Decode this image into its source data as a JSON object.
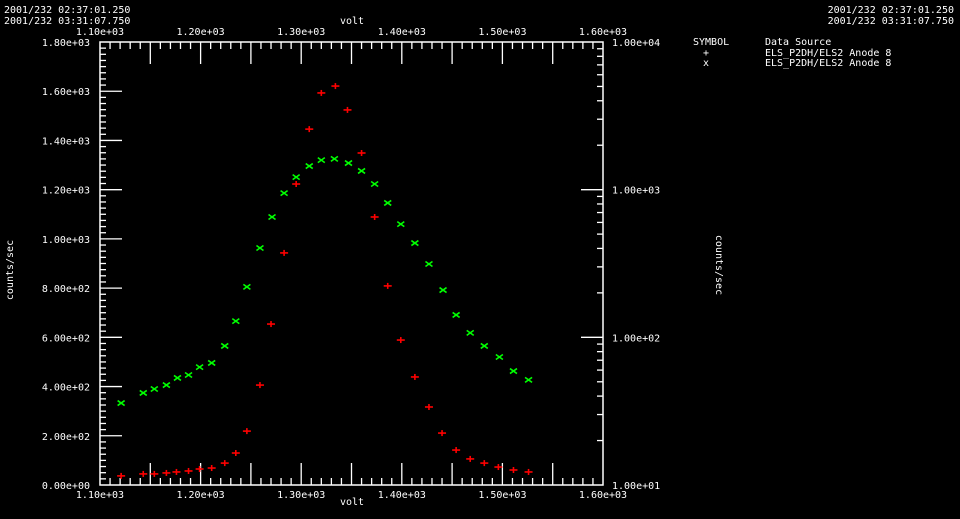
{
  "header": {
    "time_start": "2001/232 02:37:01.250",
    "time_end": "2001/232 03:31:07.750"
  },
  "legend": {
    "symbol_header": "SYMBOL",
    "source_header": "Data Source",
    "entries": [
      {
        "symbol": "+",
        "source": "ELS_P2DH/ELS2 Anode 8",
        "color": "#ff0000"
      },
      {
        "symbol": "x",
        "source": "ELS_P2DH/ELS2 Anode 8",
        "color": "#00ff00"
      }
    ]
  },
  "chart_data": {
    "type": "scatter",
    "xlabel": "volt",
    "ylabel": "counts/sec",
    "y2label": "counts/sec",
    "xlim": [
      1100,
      1600
    ],
    "ylim": [
      0,
      1800
    ],
    "y2lim": [
      10,
      10000
    ],
    "y2scale": "log",
    "x_ticks": [
      "1.10e+03",
      "1.20e+03",
      "1.30e+03",
      "1.40e+03",
      "1.50e+03",
      "1.60e+03"
    ],
    "y_ticks": [
      "0.00e+00",
      "2.00e+02",
      "4.00e+02",
      "6.00e+02",
      "8.00e+02",
      "1.00e+03",
      "1.20e+03",
      "1.40e+03",
      "1.60e+03",
      "1.80e+03"
    ],
    "y2_ticks": [
      "1.00e+01",
      "1.00e+02",
      "1.00e+03",
      "1.00e+04"
    ],
    "grid": false,
    "legend_position": "top-right",
    "series": [
      {
        "symbol": "+",
        "color": "#ff0000",
        "x": [
          1121,
          1143,
          1154,
          1166,
          1176,
          1188,
          1199,
          1211,
          1224,
          1235,
          1246,
          1259,
          1270,
          1283,
          1295,
          1308,
          1320,
          1334,
          1346,
          1360,
          1373,
          1386,
          1399,
          1413,
          1427,
          1440,
          1454,
          1468,
          1482,
          1496,
          1511,
          1526
        ],
        "y": [
          37,
          45,
          45,
          49,
          53,
          57,
          65,
          69,
          89,
          130,
          219,
          406,
          654,
          943,
          1223,
          1446,
          1593,
          1621,
          1524,
          1349,
          1089,
          809,
          589,
          439,
          317,
          211,
          142,
          106,
          89,
          73,
          61,
          53
        ]
      },
      {
        "symbol": "x",
        "color": "#00ff00",
        "x": [
          1121,
          1143,
          1154,
          1166,
          1177,
          1188,
          1199,
          1211,
          1224,
          1235,
          1246,
          1259,
          1271,
          1283,
          1295,
          1308,
          1320,
          1333,
          1347,
          1360,
          1373,
          1386,
          1399,
          1413,
          1427,
          1441,
          1454,
          1468,
          1482,
          1497,
          1511,
          1526
        ],
        "y": [
          333,
          374,
          390,
          406,
          435,
          447,
          479,
          496,
          565,
          666,
          805,
          963,
          1089,
          1186,
          1251,
          1296,
          1320,
          1325,
          1308,
          1276,
          1223,
          1146,
          1060,
          983,
          898,
          792,
          691,
          618,
          565,
          520,
          463,
          427
        ]
      }
    ]
  }
}
